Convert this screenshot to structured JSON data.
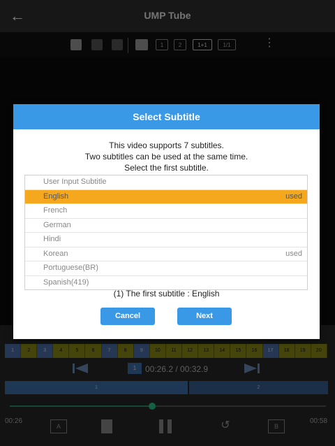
{
  "header": {
    "title": "UMP Tube"
  },
  "toolbar": {
    "buttons": [
      "1",
      "2",
      "1+1",
      "1/1"
    ]
  },
  "timeline": {
    "segments": [
      "1",
      "2",
      "3",
      "4",
      "5",
      "6",
      "7",
      "8",
      "9",
      "10",
      "11",
      "12",
      "13",
      "14",
      "15",
      "16",
      "17",
      "18",
      "19",
      "20"
    ],
    "current_index": "1",
    "time_info": "00:26.2 / 00:32.9",
    "bar1_label": "1",
    "bar2_label": "2",
    "progress": 0.45,
    "time_left": "00:26",
    "time_right": "00:58",
    "ctl_a": "A",
    "ctl_b": "B"
  },
  "dialog": {
    "title": "Select Subtitle",
    "message": [
      "This video supports 7 subtitles.",
      "Two subtitles can be used at the same time.",
      "Select the first subtitle."
    ],
    "items": [
      {
        "label": "User Input Subtitle",
        "tag": ""
      },
      {
        "label": "English",
        "tag": "used"
      },
      {
        "label": "French",
        "tag": ""
      },
      {
        "label": "German",
        "tag": ""
      },
      {
        "label": "Hindi",
        "tag": ""
      },
      {
        "label": "Korean",
        "tag": "used"
      },
      {
        "label": "Portuguese(BR)",
        "tag": ""
      },
      {
        "label": "Spanish(419)",
        "tag": ""
      }
    ],
    "selected_index": 1,
    "result": "(1) The first subtitle : English",
    "cancel_label": "Cancel",
    "next_label": "Next",
    "accent": "#3a99e6",
    "selected_color": "#f5a81e"
  }
}
